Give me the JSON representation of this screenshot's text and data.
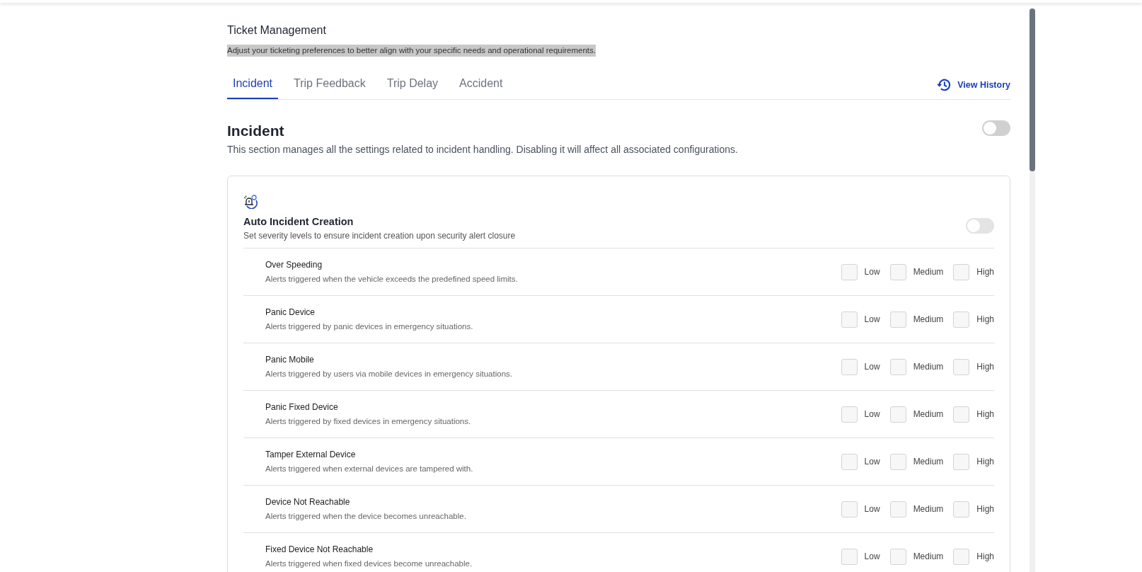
{
  "header": {
    "title": "Ticket Management",
    "subtitle": "Adjust your ticketing preferences to better align with your specific needs and operational requirements."
  },
  "tabs": [
    {
      "label": "Incident",
      "selected": true
    },
    {
      "label": "Trip Feedback",
      "selected": false
    },
    {
      "label": "Trip Delay",
      "selected": false
    },
    {
      "label": "Accident",
      "selected": false
    }
  ],
  "view_history": {
    "label": "View History"
  },
  "section": {
    "title": "Incident",
    "description": "This section manages all the settings related to incident handling. Disabling it will affect all associated configurations.",
    "on": false
  },
  "card": {
    "title": "Auto Incident Creation",
    "description": "Set severity levels to ensure incident creation upon security alert closure",
    "on": false,
    "rows": [
      {
        "name": "Over Speeding",
        "description": "Alerts triggered when the vehicle exceeds the predefined speed limits.",
        "options": [
          {
            "label": "Low",
            "checked": false
          },
          {
            "label": "Medium",
            "checked": false
          },
          {
            "label": "High",
            "checked": false
          }
        ]
      },
      {
        "name": "Panic Device",
        "description": "Alerts triggered by panic devices in emergency situations.",
        "options": [
          {
            "label": "Low",
            "checked": false
          },
          {
            "label": "Medium",
            "checked": false
          },
          {
            "label": "High",
            "checked": false
          }
        ]
      },
      {
        "name": "Panic Mobile",
        "description": "Alerts triggered by users via mobile devices in emergency situations.",
        "options": [
          {
            "label": "Low",
            "checked": false
          },
          {
            "label": "Medium",
            "checked": false
          },
          {
            "label": "High",
            "checked": false
          }
        ]
      },
      {
        "name": "Panic Fixed Device",
        "description": "Alerts triggered by fixed devices in emergency situations.",
        "options": [
          {
            "label": "Low",
            "checked": false
          },
          {
            "label": "Medium",
            "checked": false
          },
          {
            "label": "High",
            "checked": false
          }
        ]
      },
      {
        "name": "Tamper External Device",
        "description": "Alerts triggered when external devices are tampered with.",
        "options": [
          {
            "label": "Low",
            "checked": false
          },
          {
            "label": "Medium",
            "checked": false
          },
          {
            "label": "High",
            "checked": false
          }
        ]
      },
      {
        "name": "Device Not Reachable",
        "description": "Alerts triggered when the device becomes unreachable.",
        "options": [
          {
            "label": "Low",
            "checked": false
          },
          {
            "label": "Medium",
            "checked": false
          },
          {
            "label": "High",
            "checked": false
          }
        ]
      },
      {
        "name": "Fixed Device Not Reachable",
        "description": "Alerts triggered when fixed devices become unreachable.",
        "options": [
          {
            "label": "Low",
            "checked": false
          },
          {
            "label": "Medium",
            "checked": false
          },
          {
            "label": "High",
            "checked": false
          }
        ]
      }
    ]
  }
}
